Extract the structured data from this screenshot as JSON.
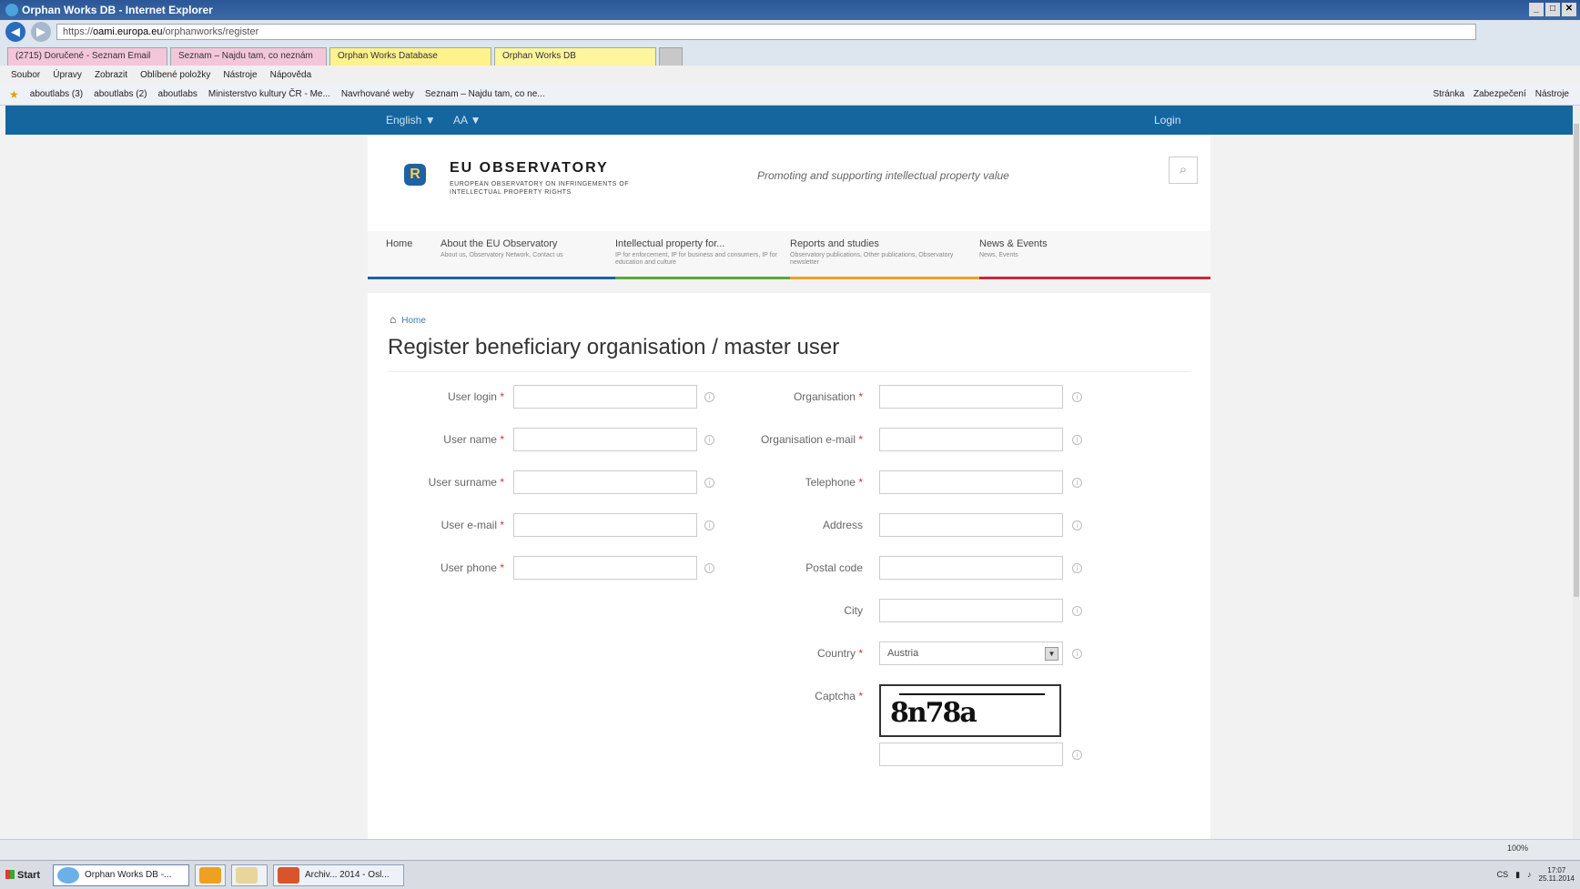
{
  "window": {
    "title": "Orphan Works DB - Internet Explorer"
  },
  "address": {
    "scheme": "https",
    "host": "oami.europa.eu",
    "path": "/orphanworks/register"
  },
  "tabs": [
    {
      "label": "(2715) Doručené - Seznam Email"
    },
    {
      "label": "Seznam – Najdu tam, co neznám"
    },
    {
      "label": "Orphan Works Database"
    },
    {
      "label": "Orphan Works DB"
    }
  ],
  "menubar": [
    "Soubor",
    "Úpravy",
    "Zobrazit",
    "Oblíbené položky",
    "Nástroje",
    "Nápověda"
  ],
  "favorites": [
    "aboutlabs (3)",
    "aboutlabs (2)",
    "aboutlabs",
    "Ministerstvo kultury ČR - Me...",
    "Navrhované weby",
    "Seznam – Najdu tam, co ne..."
  ],
  "commandbar": [
    "Stránka",
    "Zabezpečení",
    "Nástroje"
  ],
  "site": {
    "topbar": {
      "lang": "English ▼",
      "aa": "AA ▼",
      "login": "Login"
    },
    "brand": "EU OBSERVATORY",
    "brand_sub": "EUROPEAN OBSERVATORY ON INFRINGEMENTS OF INTELLECTUAL PROPERTY RIGHTS",
    "tagline": "Promoting and supporting intellectual property value",
    "nav": [
      {
        "label": "Home",
        "sub": ""
      },
      {
        "label": "About the EU Observatory",
        "sub": "About us, Observatory Network, Contact us"
      },
      {
        "label": "Intellectual property for...",
        "sub": "IP for enforcement, IP for business and consumers, IP for education and culture"
      },
      {
        "label": "Reports and studies",
        "sub": "Observatory publications, Other publications, Observatory newsletter"
      },
      {
        "label": "News & Events",
        "sub": "News, Events"
      }
    ],
    "breadcrumb": "Home",
    "page_title": "Register beneficiary organisation / master user",
    "left_fields": [
      "User login",
      "User name",
      "User surname",
      "User e-mail",
      "User phone"
    ],
    "right_fields": [
      {
        "label": "Organisation",
        "required": "*"
      },
      {
        "label": "Organisation e-mail",
        "required": "*"
      },
      {
        "label": "Telephone",
        "required": "*"
      },
      {
        "label": "Address",
        "required": ""
      },
      {
        "label": "Postal code",
        "required": ""
      },
      {
        "label": "City",
        "required": ""
      }
    ],
    "country": {
      "label": "Country",
      "value": "Austria"
    },
    "captcha": {
      "label": "Captcha",
      "text": "8n78a"
    },
    "required_mark": "*"
  },
  "statusbar": {
    "zoom": "100%"
  },
  "taskbar": {
    "start": "Start",
    "items": [
      "Orphan Works DB -...",
      "",
      "",
      "Archiv... 2014 - Osl..."
    ],
    "lang": "CS",
    "time": "17:07",
    "date": "25.11.2014"
  }
}
